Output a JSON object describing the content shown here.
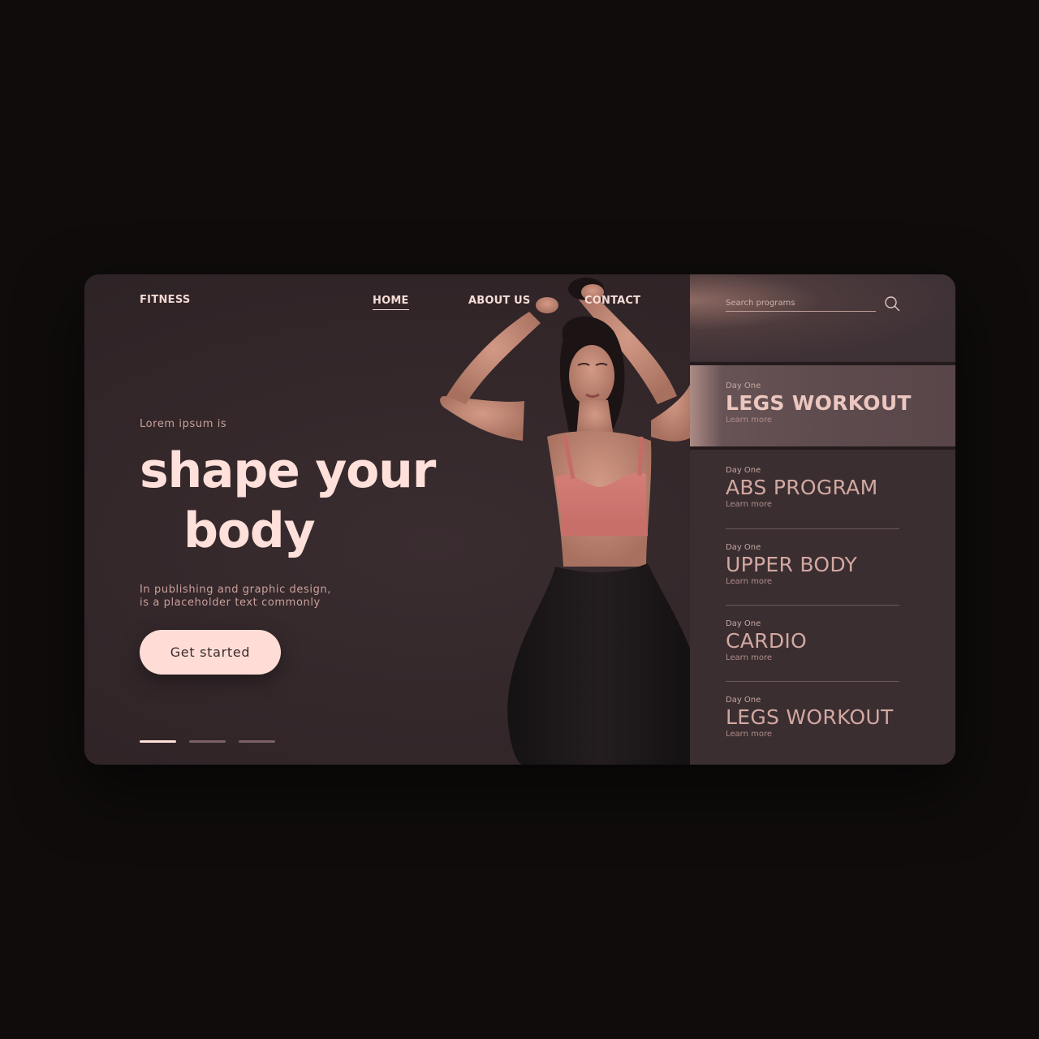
{
  "brand": "FITNESS",
  "nav": {
    "home": "HOME",
    "about": "ABOUT US",
    "contact": "CONTACT"
  },
  "hero": {
    "eyebrow": "Lorem ipsum is",
    "headline_line1": "shape your",
    "headline_line2": "body",
    "desc_line1": "In publishing and graphic design,",
    "desc_line2": "is a placeholder text commonly",
    "cta": "Get started"
  },
  "slider": {
    "count": 3,
    "active_index": 0
  },
  "search": {
    "placeholder": "Search programs"
  },
  "programs": [
    {
      "day": "Day One",
      "title": "LEGS WORKOUT",
      "link": "Learn more",
      "active": true
    },
    {
      "day": "Day One",
      "title": "ABS PROGRAM",
      "link": "Learn more",
      "active": false
    },
    {
      "day": "Day One",
      "title": "UPPER BODY",
      "link": "Learn more",
      "active": false
    },
    {
      "day": "Day One",
      "title": "CARDIO",
      "link": "Learn more",
      "active": false
    },
    {
      "day": "Day One",
      "title": "LEGS WORKOUT",
      "link": "Learn more",
      "active": false
    }
  ],
  "colors": {
    "page_bg": "#0f0c0b",
    "card_bg": "#322629",
    "accent": "#ffddd6",
    "panel_bg": "#3a2e31",
    "active_item_bg": "#5d4a4d"
  },
  "icons": [
    "search-icon"
  ]
}
